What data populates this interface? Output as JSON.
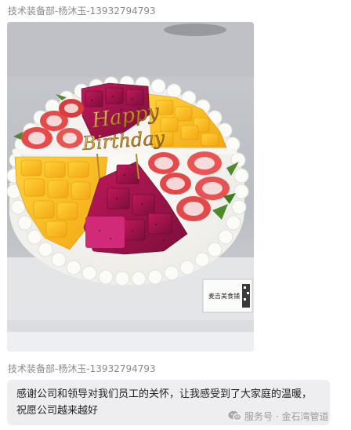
{
  "messages": [
    {
      "sender": "技术装备部-杨沐玉-13932794793",
      "type": "image",
      "image": {
        "subject": "cake-photo",
        "topper_text_1": "Happy",
        "topper_text_2": "Birthday",
        "box_label": "麦吉美食铺"
      }
    },
    {
      "sender": "技术装备部-杨沐玉-13932794793",
      "type": "text",
      "text": "感谢公司和领导对我们员工的关怀，让我感受到了大家庭的温暖，祝愿公司越来越好"
    }
  ],
  "watermark": {
    "icon": "wechat-icon",
    "text": "服务号 · 金石湾管道"
  }
}
